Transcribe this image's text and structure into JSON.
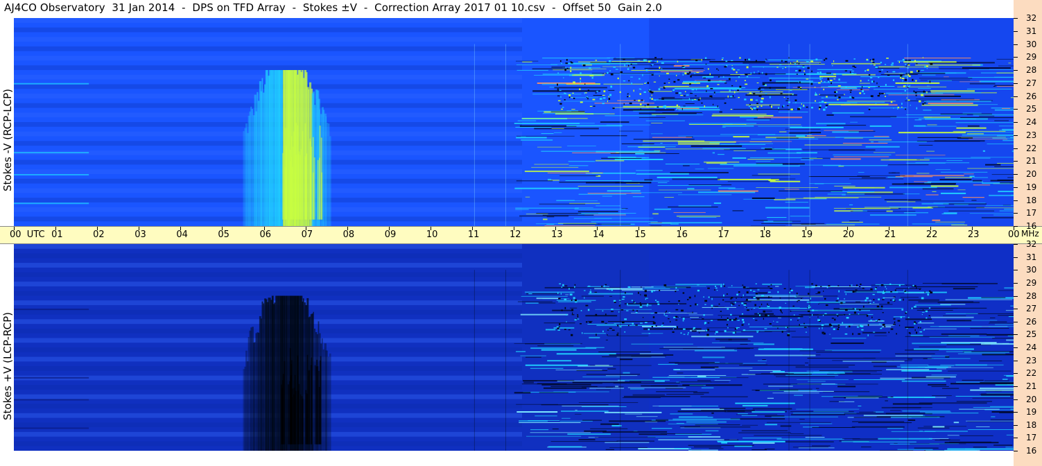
{
  "title": "AJ4CO Observatory  31 Jan 2014  -  DPS on TFD Array  -  Stokes ±V  -  Correction Array 2017 01 10.csv  -  Offset 50  Gain 2.0",
  "colors": {
    "background_blue": "#1a55ff",
    "deep_blue": "#1030c0",
    "cyan": "#20d0ff",
    "yellow_green": "#c8ff40",
    "time_axis_bg": "#fffcc0",
    "freq_axis_bg": "#fcdcc0"
  },
  "chart_data": [
    {
      "type": "heatmap",
      "panel": "upper",
      "ylabel": "Stokes -V (RCP-LCP)",
      "x_unit": "UTC",
      "x_ticks": [
        "00",
        "01",
        "02",
        "03",
        "04",
        "05",
        "06",
        "07",
        "08",
        "09",
        "10",
        "11",
        "12",
        "13",
        "14",
        "15",
        "16",
        "17",
        "18",
        "19",
        "20",
        "21",
        "22",
        "23",
        "00"
      ],
      "x_range_hours": [
        0,
        24
      ],
      "y_unit": "MHz",
      "y_range": [
        16,
        32
      ],
      "y_ticks": [
        16,
        17,
        18,
        19,
        20,
        21,
        22,
        23,
        24,
        25,
        26,
        27,
        28,
        29,
        30,
        31,
        32
      ],
      "features": [
        {
          "kind": "burst",
          "start_utc": 5.5,
          "end_utc": 7.6,
          "freq_range": [
            16,
            28
          ],
          "tone": "bright"
        },
        {
          "kind": "interference",
          "start_utc": 12.0,
          "end_utc": 24.0,
          "freq_range": [
            16,
            29
          ],
          "tone": "speckled"
        }
      ]
    },
    {
      "type": "heatmap",
      "panel": "lower",
      "ylabel": "Stokes +V (LCP-RCP)",
      "x_unit": "UTC",
      "x_ticks": [
        "00",
        "01",
        "02",
        "03",
        "04",
        "05",
        "06",
        "07",
        "08",
        "09",
        "10",
        "11",
        "12",
        "13",
        "14",
        "15",
        "16",
        "17",
        "18",
        "19",
        "20",
        "21",
        "22",
        "23",
        "00"
      ],
      "x_range_hours": [
        0,
        24
      ],
      "y_unit": "MHz",
      "y_range": [
        16,
        32
      ],
      "y_ticks": [
        16,
        17,
        18,
        19,
        20,
        21,
        22,
        23,
        24,
        25,
        26,
        27,
        28,
        29,
        30,
        31,
        32
      ],
      "features": [
        {
          "kind": "burst",
          "start_utc": 5.5,
          "end_utc": 7.6,
          "freq_range": [
            16,
            28
          ],
          "tone": "dark"
        },
        {
          "kind": "interference",
          "start_utc": 12.0,
          "end_utc": 24.0,
          "freq_range": [
            16,
            29
          ],
          "tone": "speckled"
        }
      ]
    }
  ],
  "time_axis": {
    "labels": [
      "00  UTC",
      "01",
      "02",
      "03",
      "04",
      "05",
      "06",
      "07",
      "08",
      "09",
      "10",
      "11",
      "12",
      "13",
      "14",
      "15",
      "16",
      "17",
      "18",
      "19",
      "20",
      "21",
      "22",
      "23",
      "00"
    ],
    "freq_unit_label": "MHz"
  }
}
